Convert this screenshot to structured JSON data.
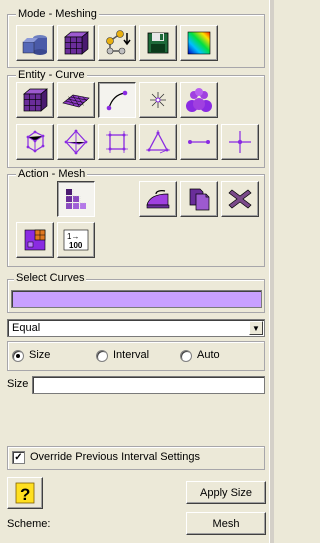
{
  "mode_group": {
    "title": "Mode - Meshing",
    "buttons": [
      {
        "icon": "geometry-volume-icon"
      },
      {
        "icon": "mesh-volume-icon"
      },
      {
        "icon": "node-export-icon"
      },
      {
        "icon": "save-disk-icon"
      },
      {
        "icon": "quality-colormap-icon"
      }
    ]
  },
  "entity_group": {
    "title": "Entity - Curve",
    "row1": [
      {
        "icon": "volume-cube-icon"
      },
      {
        "icon": "surface-mesh-icon"
      },
      {
        "icon": "curve-icon",
        "selected": true
      },
      {
        "icon": "vertex-icon"
      },
      {
        "icon": "group-icon"
      }
    ],
    "row2": [
      {
        "icon": "hex-element-icon"
      },
      {
        "icon": "tet-element-icon"
      },
      {
        "icon": "quad-element-icon"
      },
      {
        "icon": "tri-element-icon"
      },
      {
        "icon": "edge-element-icon"
      },
      {
        "icon": "node-element-icon"
      }
    ]
  },
  "action_group": {
    "title": "Action - Mesh",
    "buttons": [
      {
        "icon": "mesh-grid-icon",
        "selected": true
      },
      {
        "icon": "smooth-iron-icon"
      },
      {
        "icon": "copy-mesh-icon"
      },
      {
        "icon": "delete-mesh-icon"
      },
      {
        "icon": "refine-mesh-icon"
      },
      {
        "icon": "interval-count-icon",
        "text": "1→\n100"
      }
    ]
  },
  "select": {
    "title": "Select Curves",
    "value": ""
  },
  "scheme_dropdown": {
    "selected": "Equal"
  },
  "radios": [
    {
      "label": "Size",
      "checked": true
    },
    {
      "label": "Interval",
      "checked": false
    },
    {
      "label": "Auto",
      "checked": false
    }
  ],
  "size_field": {
    "label": "Size",
    "value": ""
  },
  "override": {
    "label": "Override Previous Interval Settings",
    "checked": true
  },
  "help_button": {
    "icon": "help-question-icon"
  },
  "apply_size_button": {
    "label": "Apply Size"
  },
  "scheme": {
    "label": "Scheme:",
    "button_label": "Mesh"
  },
  "colors": {
    "background": "#ece9d8",
    "selection_field": "#c8a0ff",
    "icon_purple": "#8a2be2"
  }
}
